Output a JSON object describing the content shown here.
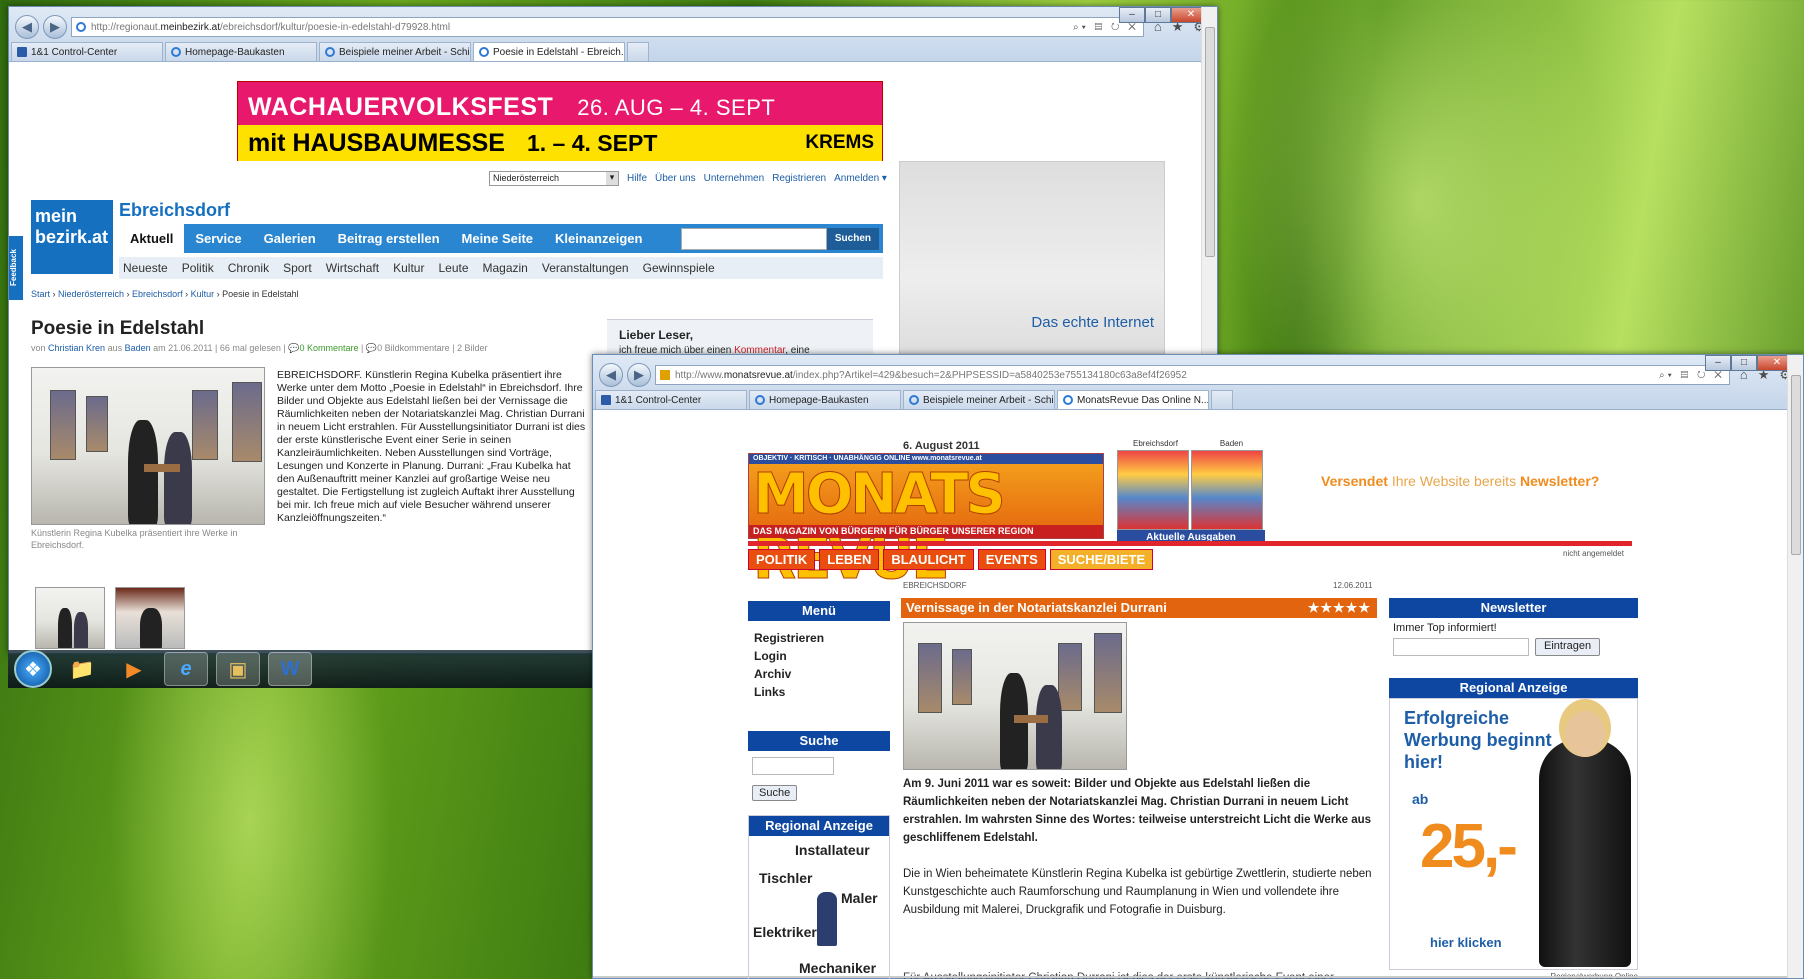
{
  "window1": {
    "url_prefix": "http://regionaut.",
    "url_domain": "meinbezirk.at",
    "url_path": "/ebreichsdorf/kultur/poesie-in-edelstahl-d79928.html",
    "tabs": [
      {
        "label": "1&1 Control-Center",
        "active": false
      },
      {
        "label": "Homepage-Baukasten",
        "active": false
      },
      {
        "label": "Beispiele meiner Arbeit - Schie...",
        "active": false
      },
      {
        "label": "Poesie in Edelstahl - Ebreich...",
        "active": true
      }
    ],
    "banner": {
      "line1": "WACHAUERVOLKSFEST",
      "line1_dates": "26. AUG – 4. SEPT",
      "line2": "mit HAUSBAUMESSE",
      "line2_dates": "1. – 4. SEPT",
      "place": "KREMS"
    },
    "region_select": "Niederösterreich",
    "top_links": [
      "Hilfe",
      "Über uns",
      "Unternehmen",
      "Registrieren",
      "Anmelden"
    ],
    "logo_l1": "mein",
    "logo_l2": "bezirk.at",
    "feedback": "Feedback",
    "city": "Ebreichsdorf",
    "main_nav": [
      "Aktuell",
      "Service",
      "Galerien",
      "Beitrag erstellen",
      "Meine Seite",
      "Kleinanzeigen"
    ],
    "search_button": "Suchen",
    "sub_nav": [
      "Neueste",
      "Politik",
      "Chronik",
      "Sport",
      "Wirtschaft",
      "Kultur",
      "Leute",
      "Magazin",
      "Veranstaltungen",
      "Gewinnspiele"
    ],
    "breadcrumbs": [
      "Start",
      "Niederösterreich",
      "Ebreichsdorf",
      "Kultur",
      "Poesie in Edelstahl"
    ],
    "title": "Poesie in Edelstahl",
    "byline": {
      "von": "von",
      "author": "Christian Kren",
      "aus": "aus",
      "place": "Baden",
      "meta": "am 21.06.2011 | 66 mal gelesen |",
      "comments": "0 Kommentare",
      "sep": "|",
      "img_comments": "0 Bildkommentare",
      "pics": "| 2 Bilder"
    },
    "caption": "Künstlerin Regina Kubelka präsentiert ihre Werke in Ebreichsdorf.",
    "body": "EBREICHSDORF. Künstlerin Regina Kubelka präsentiert ihre Werke unter dem Motto „Poesie in Edelstahl“ in Ebreichsdorf. Ihre Bilder und Objekte aus Edelstahl ließen bei der Vernissage die Räumlichkeiten neben der Notariatskanzlei Mag. Christian Durrani in neuem Licht erstrahlen. Für Ausstellungsinitiator Durrani ist dies der erste künstlerische Event einer Serie in seinen Kanzleiräumlichkeiten. Neben Ausstellungen sind Vorträge, Lesungen und Konzerte in Planung. Durrani: „Frau Kubelka hat den Außenauftritt meiner Kanzlei auf großartige Weise neu gestaltet. Die Fertigstellung ist zugleich Auftakt ihrer Ausstellung bei mir. Ich freue mich auf viele Besucher während unserer Kanzleiöffnungszeiten.“",
    "ad_text": "Das echte Internet",
    "reader_title": "Lieber Leser,",
    "reader_text": "ich freue mich über einen",
    "reader_link": "Kommentar",
    "reader_tail": ", eine"
  },
  "taskbar": {
    "items": [
      {
        "icon": "start-orb-icon",
        "glyph": "❖"
      },
      {
        "icon": "folder-icon",
        "glyph": "📁"
      },
      {
        "icon": "media-player-icon",
        "glyph": "▶"
      },
      {
        "icon": "internet-explorer-icon",
        "glyph": "e"
      },
      {
        "icon": "app-icon",
        "glyph": "▣"
      },
      {
        "icon": "word-icon",
        "glyph": "W"
      }
    ]
  },
  "window2": {
    "url_prefix": "http://www.",
    "url_domain": "monatsrevue.at",
    "url_path": "/index.php?Artikel=429&besuch=2&PHPSESSID=a5840253e755134180c63a8ef4f26952",
    "tabs": [
      {
        "label": "1&1 Control-Center",
        "active": false
      },
      {
        "label": "Homepage-Baukasten",
        "active": false
      },
      {
        "label": "Beispiele meiner Arbeit - Schie...",
        "active": false
      },
      {
        "label": "MonatsRevue Das Online N...",
        "active": true
      }
    ],
    "date": "6. August 2011",
    "logo_top": "OBJEKTIV · KRITISCH · UNABHÄNGIG   ONLINE   www.monatsrevue.at",
    "logo_big": "MONATS REVUE",
    "logo_bottom": "DAS MAGAZIN VON BÜRGERN FÜR BÜRGER UNSERER REGION",
    "covers_labels": [
      "Ebreichsdorf",
      "Baden"
    ],
    "covers_button": "Aktuelle Ausgaben",
    "newsletter_ad": {
      "a": "Versendet",
      "b": " Ihre Website bereits ",
      "c": "Newsletter?"
    },
    "login_status": "nicht angemeldet",
    "nav": [
      "POLITIK",
      "LEBEN",
      "BLAULICHT",
      "EVENTS",
      "SUCHE/BIETE"
    ],
    "menu_title": "Menü",
    "menu": [
      "Registrieren",
      "Login",
      "Archiv",
      "Links"
    ],
    "search_title": "Suche",
    "search_button": "Suche",
    "regional_title": "Regional Anzeige",
    "trades": [
      "Installateur",
      "Tischler",
      "Maler",
      "Elektriker",
      "Mechaniker"
    ],
    "article_place": "EBREICHSDORF",
    "article_date": "12.06.2011",
    "article_title": "Vernissage in der Notariatskanzlei Durrani",
    "article_stars": "★★★★★",
    "rating": 5,
    "lead": "Am 9. Juni 2011 war es soweit: Bilder und Objekte aus Edelstahl ließen die Räumlichkeiten neben der Notariatskanzlei Mag. Christian Durrani in neuem Licht erstrahlen. Im wahrsten Sinne des Wortes: teilweise unterstreicht Licht die Werke aus geschliffenem Edelstahl.",
    "para": "Die in Wien beheimatete Künstlerin Regina Kubelka ist gebürtige Zwettlerin, studierte neben Kunstgeschichte auch Raumforschung und Raumplanung in Wien und vollendete ihre Ausbildung mit Malerei, Druckgrafik und Fotografie in Duisburg.",
    "para2": "Für Ausstellungsinitiator Christian Durrani ist dies der erste künstlerische Event einer",
    "newsletter_title": "Newsletter",
    "newsletter_text": "Immer Top informiert!",
    "newsletter_button": "Eintragen",
    "regional_right_title": "Regional Anzeige",
    "ad_headline": "Erfolgreiche Werbung beginnt hier!",
    "ad_from": "ab",
    "ad_price": "25,-",
    "ad_link": "hier klicken",
    "ad_footer": "Regionalwerbung Online"
  }
}
